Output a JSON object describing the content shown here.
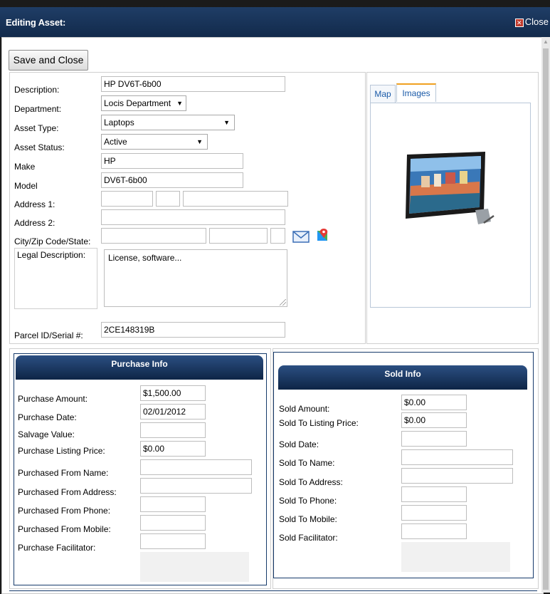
{
  "window": {
    "title": "Editing Asset:",
    "close_label": "Close"
  },
  "toolbar": {
    "save_close_label": "Save and Close"
  },
  "asset": {
    "description_label": "Description:",
    "description": "HP DV6T-6b00",
    "department_label": "Department:",
    "department": "Locis Department",
    "asset_type_label": "Asset Type:",
    "asset_type": "Laptops",
    "asset_status_label": "Asset Status:",
    "asset_status": "Active",
    "make_label": "Make",
    "make": "HP",
    "model_label": "Model",
    "model": "DV6T-6b00",
    "address1_label": "Address 1:",
    "address2_label": "Address 2:",
    "city_zip_state_label": "City/Zip Code/State:",
    "legal_description_label": "Legal Description:",
    "legal_description": "License, software...",
    "parcel_label": "Parcel ID/Serial #:",
    "parcel": "2CE148319B"
  },
  "media_tabs": {
    "map_label": "Map",
    "images_label": "Images"
  },
  "icons": {
    "mail": "envelope-icon",
    "map": "map-pin-icon",
    "down": "chevron-down-icon",
    "scroll_up": "scroll-up-arrow-icon"
  },
  "purchase": {
    "header": "Purchase Info",
    "amount_label": "Purchase Amount:",
    "amount": "$1,500.00",
    "date_label": "Purchase Date:",
    "date": "02/01/2012",
    "salvage_label": "Salvage Value:",
    "salvage": "",
    "listing_label": "Purchase Listing Price:",
    "listing": "$0.00",
    "from_name_label": "Purchased From Name:",
    "from_address_label": "Purchased From Address:",
    "from_phone_label": "Purchased From Phone:",
    "from_mobile_label": "Purchased From Mobile:",
    "facilitator_label": "Purchase Facilitator:"
  },
  "sold": {
    "header": "Sold Info",
    "amount_label": "Sold Amount:",
    "amount": "$0.00",
    "listing_label": "Sold To Listing Price:",
    "listing": "$0.00",
    "date_label": "Sold Date:",
    "to_name_label": "Sold To Name:",
    "to_address_label": "Sold To Address:",
    "to_phone_label": "Sold To Phone:",
    "to_mobile_label": "Sold To Mobile:",
    "facilitator_label": "Sold Facilitator:"
  },
  "colors": {
    "header_dark": "#0e2546",
    "header_light": "#2b4f82",
    "tab_link": "#1a5aa8",
    "tab_active_accent": "#f0a020"
  }
}
